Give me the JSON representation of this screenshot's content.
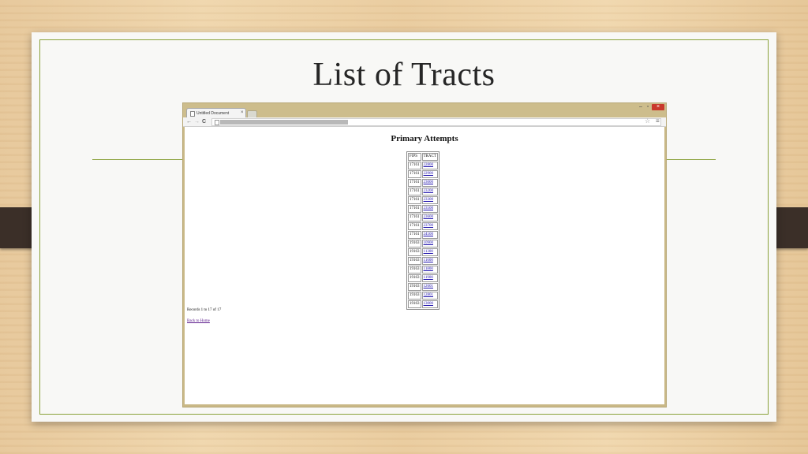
{
  "slide": {
    "title": "List of Tracts"
  },
  "browser": {
    "tab_title": "Untitled Document",
    "tab_close": "×",
    "window_controls": {
      "minimize": "–",
      "maximize": "▫",
      "close": "×"
    },
    "nav": {
      "back": "←",
      "forward": "→",
      "reload": "C"
    },
    "star": "☆",
    "menu": "≡"
  },
  "page": {
    "heading": "Primary Attempts",
    "table": {
      "headers": [
        "FIPS",
        "TRACT"
      ],
      "rows": [
        [
          "17161",
          "22800"
        ],
        [
          "17161",
          "22900"
        ],
        [
          "17161",
          "23000"
        ],
        [
          "17161",
          "23200"
        ],
        [
          "17161",
          "23300"
        ],
        [
          "17161",
          "23500"
        ],
        [
          "17161",
          "23600"
        ],
        [
          "17161",
          "23700"
        ],
        [
          "17161",
          "24500"
        ],
        [
          "19163",
          "10900"
        ],
        [
          "19163",
          "11300"
        ],
        [
          "19163",
          "11600"
        ],
        [
          "19163",
          "11800"
        ],
        [
          "19163",
          "11900"
        ],
        [
          "19163",
          "12601"
        ],
        [
          "19163",
          "12801"
        ],
        [
          "19163",
          "13000"
        ]
      ]
    },
    "records_text": "Records 1 to 17 of 17",
    "back_link": "Back to Home"
  },
  "colors": {
    "slide_accent": "#8aa13a",
    "browser_frame": "#c9b886",
    "close_button": "#c9392c",
    "link": "#1a0dab",
    "visited_link": "#5a1a8b"
  }
}
